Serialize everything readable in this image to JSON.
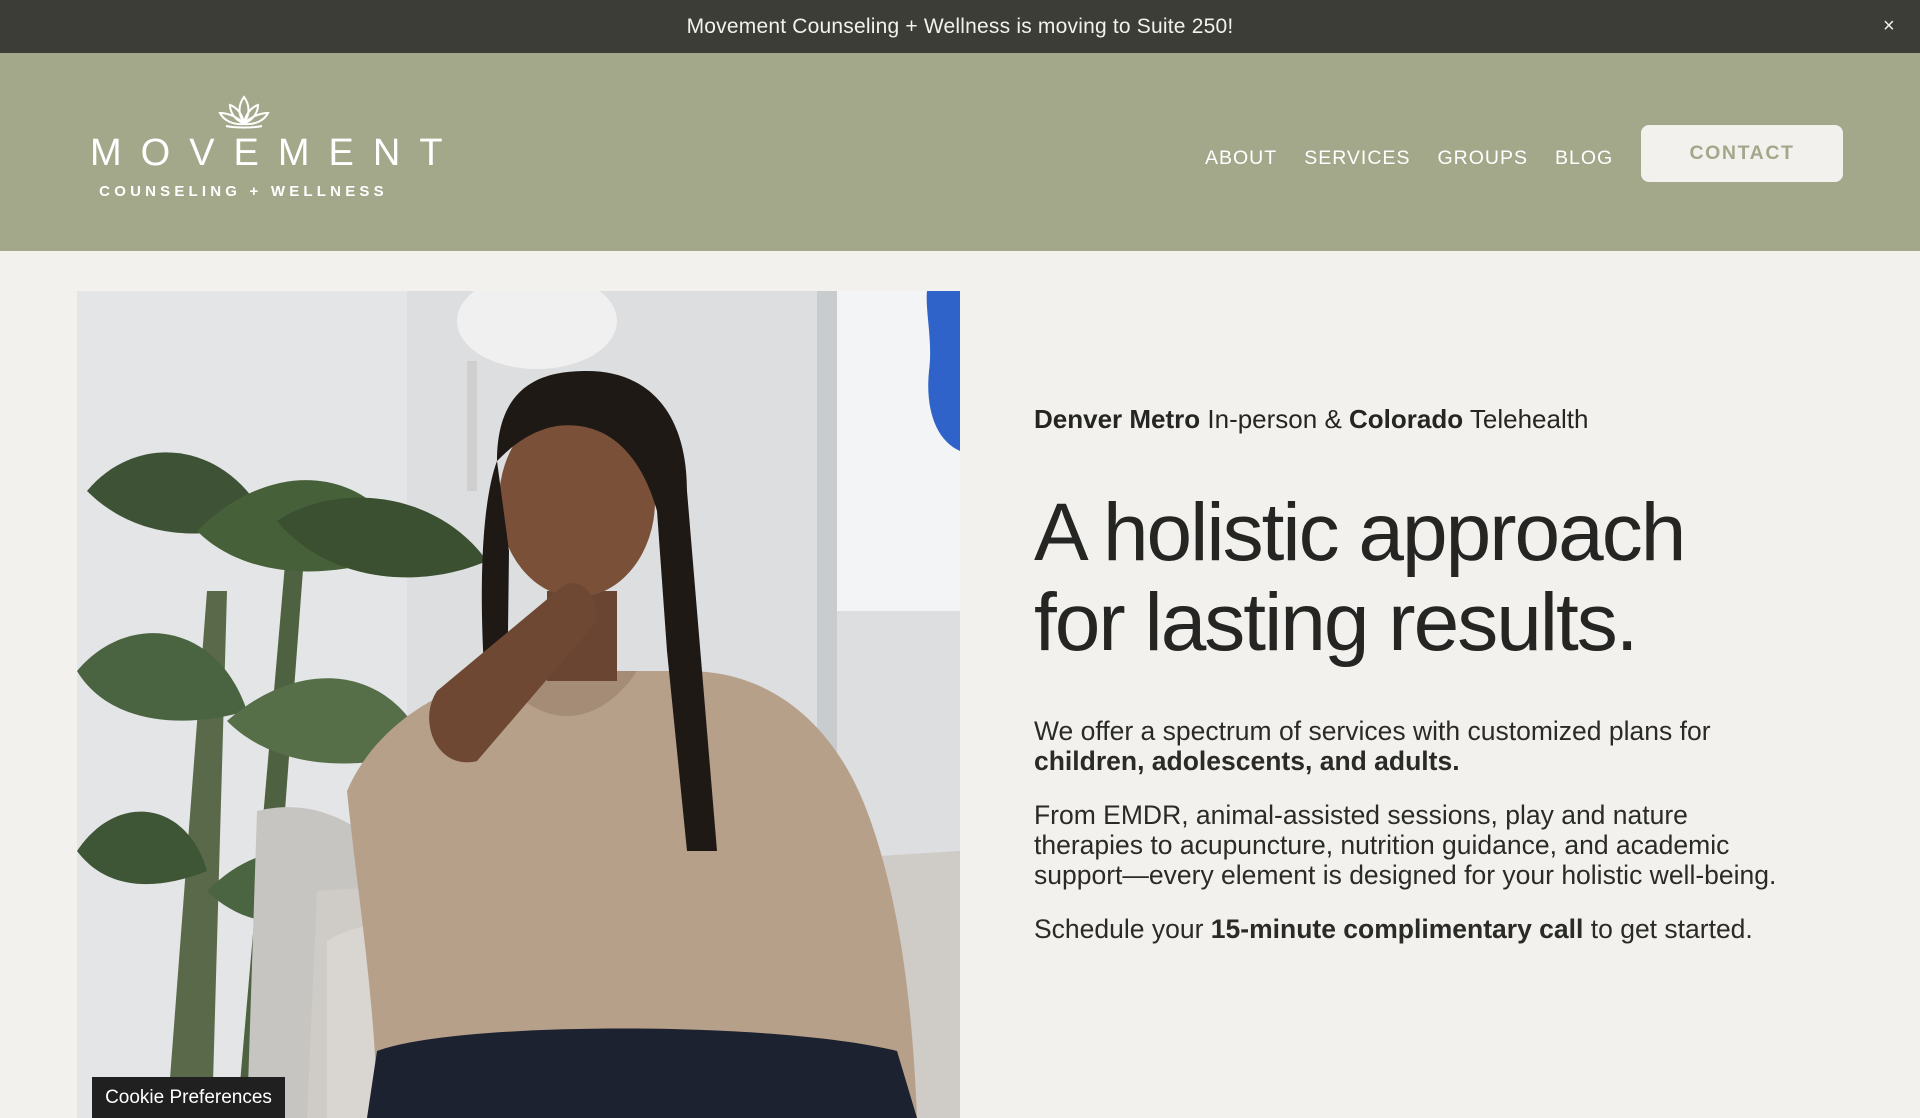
{
  "announcement": {
    "text": "Movement Counseling + Wellness is moving to Suite 250!",
    "close_icon": "close-icon",
    "close_glyph": "×"
  },
  "header": {
    "logo": {
      "word": "MOVEMENT",
      "sub": "COUNSELING + WELLNESS",
      "icon": "lotus-icon"
    },
    "nav": [
      "ABOUT",
      "SERVICES",
      "GROUPS",
      "BLOG"
    ],
    "contact_label": "CONTACT"
  },
  "hero": {
    "location": {
      "part1_bold": "Denver Metro",
      "part2": " In-person & ",
      "part3_bold": "Colorado",
      "part4": " Telehealth"
    },
    "headline_line1": "A holistic approach",
    "headline_line2": "for lasting results.",
    "p1_text": "We offer a spectrum of services with customized plans for ",
    "p1_bold": "children, adolescents, and adults.",
    "p2_text": "From EMDR, animal-assisted sessions, play and nature therapies to acupuncture, nutrition guidance, and academic support—every element is designed for your holistic well-being.",
    "p3_text1": "Schedule your ",
    "p3_bold": "15-minute complimentary call",
    "p3_text2": " to get started.",
    "photo": "photo of man in tan sweater seated beside a plant"
  },
  "cookie": {
    "label": "Cookie Preferences"
  },
  "colors": {
    "announcement_bg": "#3c3d37",
    "header_bg": "#a4a88a",
    "page_bg": "#f2f1ed",
    "text": "#252523"
  }
}
